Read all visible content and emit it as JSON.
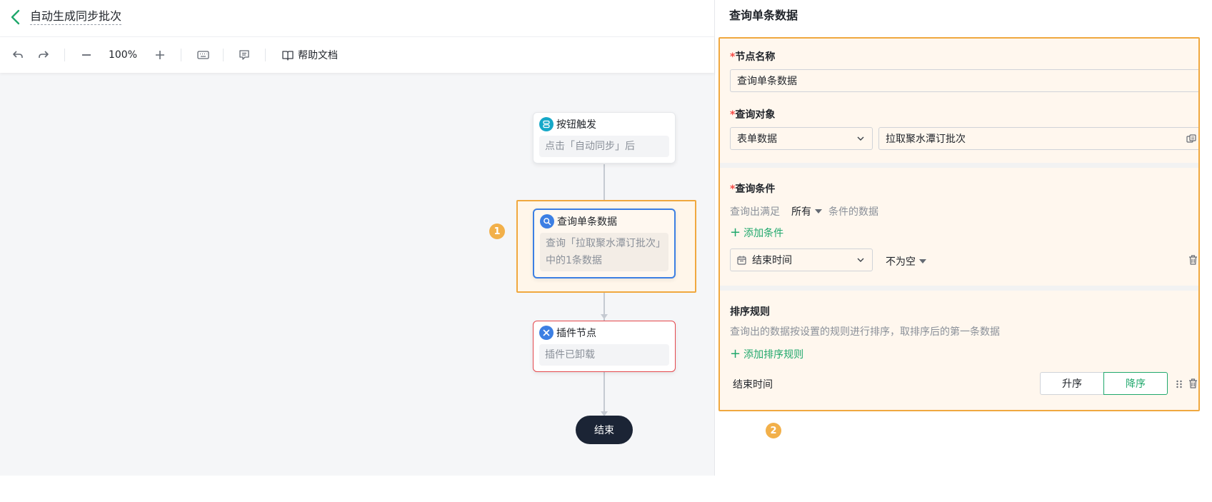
{
  "header": {
    "title": "自动生成同步批次"
  },
  "toolbar": {
    "zoom": "100%",
    "help_label": "帮助文档"
  },
  "flow": {
    "nodes": [
      {
        "title": "按钮触发",
        "desc": "点击「自动同步」后",
        "icon": "database-icon",
        "icon_color": "#16a8c8"
      },
      {
        "title": "查询单条数据",
        "desc": "查询「拉取聚水潭订批次」中的1条数据",
        "icon": "search-icon",
        "icon_color": "#3c7fe3"
      },
      {
        "title": "插件节点",
        "desc": "插件已卸载",
        "icon": "plugin-icon",
        "icon_color": "#3c7fe3"
      }
    ],
    "end_label": "结束",
    "badge_1": "1",
    "badge_2": "2"
  },
  "panel": {
    "title": "查询单条数据",
    "node_name": {
      "label": "节点名称",
      "value": "查询单条数据"
    },
    "query_object": {
      "label": "查询对象",
      "type_value": "表单数据",
      "target_value": "拉取聚水潭订批次"
    },
    "conditions": {
      "label": "查询条件",
      "prefix": "查询出满足",
      "match": "所有",
      "suffix": "条件的数据",
      "add_label": "添加条件",
      "field": "结束时间",
      "operator": "不为空"
    },
    "sort": {
      "label": "排序规则",
      "hint": "查询出的数据按设置的规则进行排序，取排序后的第一条数据",
      "add_label": "添加排序规则",
      "field": "结束时间",
      "asc_label": "升序",
      "desc_label": "降序",
      "selected": "降序"
    }
  },
  "colors": {
    "accent": "#20a86c",
    "highlight": "#f0a83f",
    "node_selected": "#3c7fe3",
    "node_error": "#e5484d"
  }
}
